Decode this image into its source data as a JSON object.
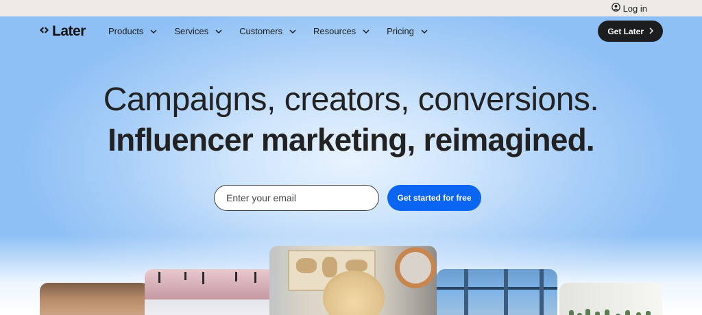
{
  "topbar": {
    "login_label": "Log in"
  },
  "nav": {
    "logo_text": "Later",
    "menu": [
      {
        "label": "Products"
      },
      {
        "label": "Services"
      },
      {
        "label": "Customers"
      },
      {
        "label": "Resources"
      },
      {
        "label": "Pricing"
      }
    ],
    "cta_label": "Get Later"
  },
  "hero": {
    "headline_line1": "Campaigns, creators, conversions.",
    "headline_line2": "Influencer marketing, reimagined.",
    "email_placeholder": "Enter your email",
    "signup_button": "Get started for free"
  },
  "icons": {
    "login": "user-circle-icon",
    "logo": "later-logo-icon",
    "menu_chevron": "chevron-down-icon",
    "cta_arrow": "chevron-right-icon"
  },
  "colors": {
    "primary_blue": "#0a66f2",
    "dark_button": "#1c1d1f",
    "hero_blue": "#8fc0f5"
  }
}
